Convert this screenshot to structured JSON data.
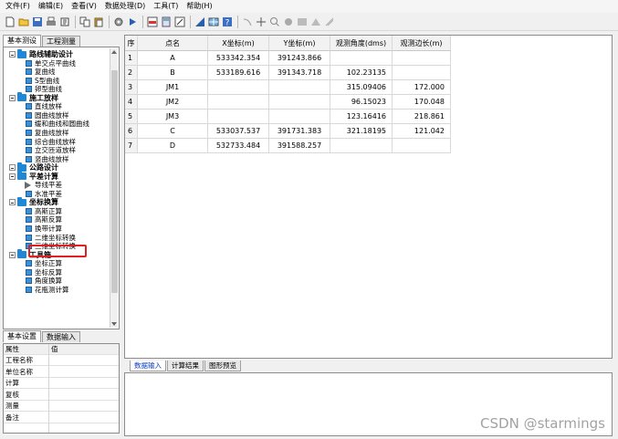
{
  "menu": [
    "文件(F)",
    "编辑(E)",
    "查看(V)",
    "数据处理(D)",
    "工具(T)",
    "帮助(H)"
  ],
  "toolbar_icons": [
    "new-icon",
    "open-icon",
    "save-icon",
    "print-icon",
    "cut-icon",
    "copy-icon",
    "paste-icon",
    "settings-icon",
    "run-icon",
    "chart-icon",
    "calc-icon",
    "edit-icon",
    "poly-icon",
    "table-icon",
    "help-icon",
    "line-icon",
    "cross-icon",
    "zoom-icon",
    "pan-icon",
    "fill-icon",
    "dim-icon",
    "redraw-icon"
  ],
  "left_tabs": [
    "基本测设",
    "工程测量"
  ],
  "tree": [
    {
      "type": "cat",
      "label": "路线辅助设计"
    },
    {
      "type": "leaf",
      "label": "单交点平曲线"
    },
    {
      "type": "leaf",
      "label": "复曲线"
    },
    {
      "type": "leaf",
      "label": "S型曲线"
    },
    {
      "type": "leaf",
      "label": "卵型曲线"
    },
    {
      "type": "cat",
      "label": "施工放样"
    },
    {
      "type": "leaf",
      "label": "直线放样"
    },
    {
      "type": "leaf",
      "label": "圆曲线放样"
    },
    {
      "type": "leaf",
      "label": "缓和曲线和圆曲线"
    },
    {
      "type": "leaf",
      "label": "复曲线放样"
    },
    {
      "type": "leaf",
      "label": "综合曲线放样"
    },
    {
      "type": "leaf",
      "label": "立交匝道放样"
    },
    {
      "type": "leaf",
      "label": "竖曲线放样"
    },
    {
      "type": "cat",
      "label": "公路设计"
    },
    {
      "type": "cat",
      "label": "平差计算"
    },
    {
      "type": "play",
      "label": "导线平差"
    },
    {
      "type": "leaf",
      "label": "水准平差"
    },
    {
      "type": "cat",
      "label": "坐标换算"
    },
    {
      "type": "leaf",
      "label": "高斯正算"
    },
    {
      "type": "leaf",
      "label": "高斯反算"
    },
    {
      "type": "leaf",
      "label": "换带计算"
    },
    {
      "type": "leaf",
      "label": "二维坐标转换"
    },
    {
      "type": "leaf",
      "label": "三维坐标转换"
    },
    {
      "type": "cat",
      "label": "工具箱"
    },
    {
      "type": "leaf",
      "label": "坐标正算"
    },
    {
      "type": "leaf",
      "label": "坐标反算"
    },
    {
      "type": "leaf",
      "label": "角度换算"
    },
    {
      "type": "leaf",
      "label": "花瓶测计算"
    }
  ],
  "lower_left_tabs": [
    "基本设置",
    "数据输入"
  ],
  "props": {
    "header": {
      "key": "属性",
      "value": "值"
    },
    "rows": [
      "工程名称",
      "单位名称",
      "计算",
      "复核",
      "测量",
      "备注"
    ]
  },
  "grid": {
    "columns": [
      "序",
      "点名",
      "X坐标(m)",
      "Y坐标(m)",
      "观测角度(dms)",
      "观测边长(m)"
    ],
    "rows": [
      [
        "1",
        "A",
        "533342.354",
        "391243.866",
        "",
        ""
      ],
      [
        "2",
        "B",
        "533189.616",
        "391343.718",
        "102.23135",
        ""
      ],
      [
        "3",
        "JM1",
        "",
        "",
        "315.09406",
        "172.000"
      ],
      [
        "4",
        "JM2",
        "",
        "",
        "96.15023",
        "170.048"
      ],
      [
        "5",
        "JM3",
        "",
        "",
        "123.16416",
        "218.861"
      ],
      [
        "6",
        "C",
        "533037.537",
        "391731.383",
        "321.18195",
        "121.042"
      ],
      [
        "7",
        "D",
        "532733.484",
        "391588.257",
        "",
        ""
      ]
    ]
  },
  "lower_tabs": [
    "数据输入",
    "计算结果",
    "图形预览"
  ],
  "watermark": "CSDN @starmings"
}
